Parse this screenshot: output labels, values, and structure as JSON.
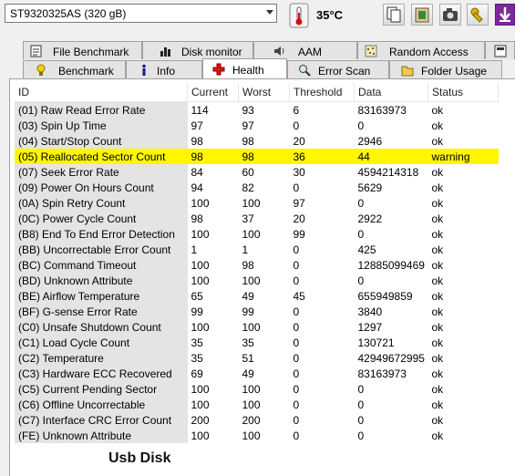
{
  "toolbar": {
    "drive": "ST9320325AS (320 gB)",
    "temperature": "35°C"
  },
  "tabs_top": [
    {
      "label": "File Benchmark",
      "icon": "file-benchmark-icon"
    },
    {
      "label": "Disk monitor",
      "icon": "disk-monitor-icon"
    },
    {
      "label": "AAM",
      "icon": "speaker-icon"
    },
    {
      "label": "Random Access",
      "icon": "random-access-icon"
    }
  ],
  "tabs_bottom": [
    {
      "label": "Benchmark",
      "icon": "benchmark-icon"
    },
    {
      "label": "Info",
      "icon": "info-icon"
    },
    {
      "label": "Health",
      "icon": "health-cross-icon",
      "active": true
    },
    {
      "label": "Error Scan",
      "icon": "magnifier-icon"
    },
    {
      "label": "Folder Usage",
      "icon": "folder-icon"
    }
  ],
  "columns": [
    "ID",
    "Current",
    "Worst",
    "Threshold",
    "Data",
    "Status"
  ],
  "rows": [
    [
      "(01) Raw Read Error Rate",
      "114",
      "93",
      "6",
      "83163973",
      "ok"
    ],
    [
      "(03) Spin Up Time",
      "97",
      "97",
      "0",
      "0",
      "ok"
    ],
    [
      "(04) Start/Stop Count",
      "98",
      "98",
      "20",
      "2946",
      "ok"
    ],
    [
      "(05) Reallocated Sector Count",
      "98",
      "98",
      "36",
      "44",
      "warning"
    ],
    [
      "(07) Seek Error Rate",
      "84",
      "60",
      "30",
      "4594214318",
      "ok"
    ],
    [
      "(09) Power On Hours Count",
      "94",
      "82",
      "0",
      "5629",
      "ok"
    ],
    [
      "(0A) Spin Retry Count",
      "100",
      "100",
      "97",
      "0",
      "ok"
    ],
    [
      "(0C) Power Cycle Count",
      "98",
      "37",
      "20",
      "2922",
      "ok"
    ],
    [
      "(B8) End To End Error Detection",
      "100",
      "100",
      "99",
      "0",
      "ok"
    ],
    [
      "(BB) Uncorrectable Error Count",
      "1",
      "1",
      "0",
      "425",
      "ok"
    ],
    [
      "(BC) Command Timeout",
      "100",
      "98",
      "0",
      "12885099469",
      "ok"
    ],
    [
      "(BD) Unknown Attribute",
      "100",
      "100",
      "0",
      "0",
      "ok"
    ],
    [
      "(BE) Airflow Temperature",
      "65",
      "49",
      "45",
      "655949859",
      "ok"
    ],
    [
      "(BF) G-sense Error Rate",
      "99",
      "99",
      "0",
      "3840",
      "ok"
    ],
    [
      "(C0) Unsafe Shutdown Count",
      "100",
      "100",
      "0",
      "1297",
      "ok"
    ],
    [
      "(C1) Load Cycle Count",
      "35",
      "35",
      "0",
      "130721",
      "ok"
    ],
    [
      "(C2) Temperature",
      "35",
      "51",
      "0",
      "42949672995",
      "ok"
    ],
    [
      "(C3) Hardware ECC Recovered",
      "69",
      "49",
      "0",
      "83163973",
      "ok"
    ],
    [
      "(C5) Current Pending Sector",
      "100",
      "100",
      "0",
      "0",
      "ok"
    ],
    [
      "(C6) Offline Uncorrectable",
      "100",
      "100",
      "0",
      "0",
      "ok"
    ],
    [
      "(C7) Interface CRC Error Count",
      "200",
      "200",
      "0",
      "0",
      "ok"
    ],
    [
      "(FE) Unknown Attribute",
      "100",
      "100",
      "0",
      "0",
      "ok"
    ]
  ],
  "caption": "Usb Disk",
  "colors": {
    "warning_row": "#fff600",
    "id_column_bg": "#e4e4e4",
    "panel_bg": "#ffffff"
  }
}
